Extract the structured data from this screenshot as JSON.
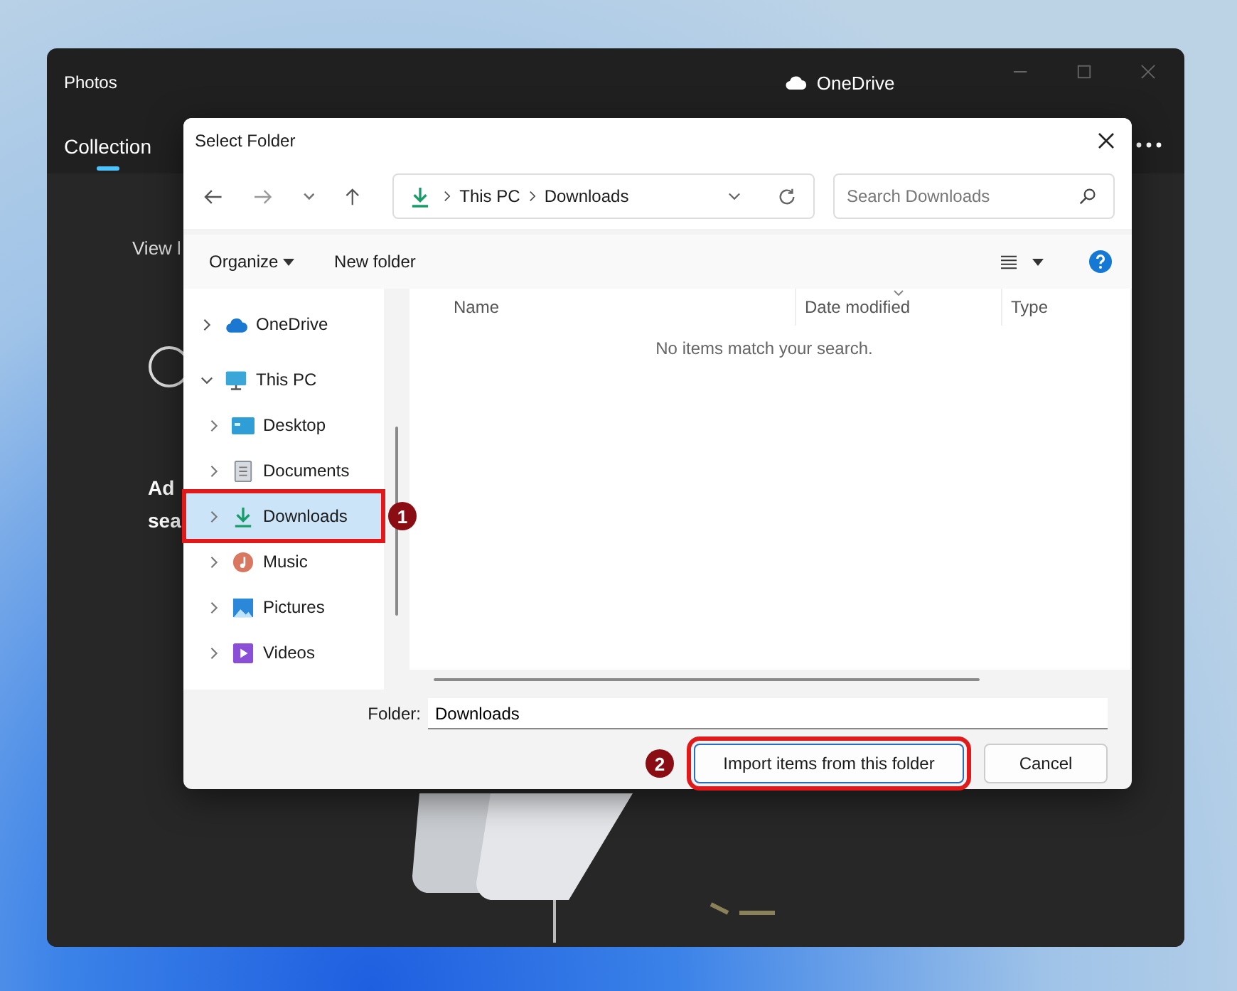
{
  "app": {
    "title": "Photos",
    "account": "OneDrive",
    "tabs": [
      {
        "label": "Collection",
        "selected": true
      }
    ],
    "view_text": "View l",
    "heading": [
      "Ad",
      "sea"
    ]
  },
  "dialog": {
    "title": "Select Folder",
    "breadcrumb": [
      "This PC",
      "Downloads"
    ],
    "search": {
      "placeholder": "Search Downloads"
    },
    "toolbar": {
      "organize": "Organize",
      "new_folder": "New folder"
    },
    "nav": [
      {
        "label": "OneDrive",
        "kind": "cloud",
        "expanded": false,
        "selected": false
      },
      {
        "label": "This PC",
        "kind": "computer",
        "expanded": true,
        "selected": false,
        "children": [
          {
            "label": "Desktop",
            "kind": "desktop",
            "expanded": false,
            "selected": false
          },
          {
            "label": "Documents",
            "kind": "documents",
            "expanded": false,
            "selected": false
          },
          {
            "label": "Downloads",
            "kind": "downloads",
            "expanded": false,
            "selected": true,
            "callout": "1"
          },
          {
            "label": "Music",
            "kind": "music",
            "expanded": false,
            "selected": false
          },
          {
            "label": "Pictures",
            "kind": "pictures",
            "expanded": false,
            "selected": false
          },
          {
            "label": "Videos",
            "kind": "videos",
            "expanded": false,
            "selected": false
          }
        ]
      }
    ],
    "columns": [
      {
        "label": "Name",
        "sorted": false
      },
      {
        "label": "Date modified",
        "sorted": true
      },
      {
        "label": "Type",
        "sorted": false
      }
    ],
    "empty_message": "No items match your search.",
    "folder_label": "Folder:",
    "folder_value": "Downloads",
    "buttons": [
      {
        "label": "Import items from this folder",
        "kind": "primary",
        "callout": "2"
      },
      {
        "label": "Cancel",
        "kind": "secondary"
      }
    ]
  }
}
